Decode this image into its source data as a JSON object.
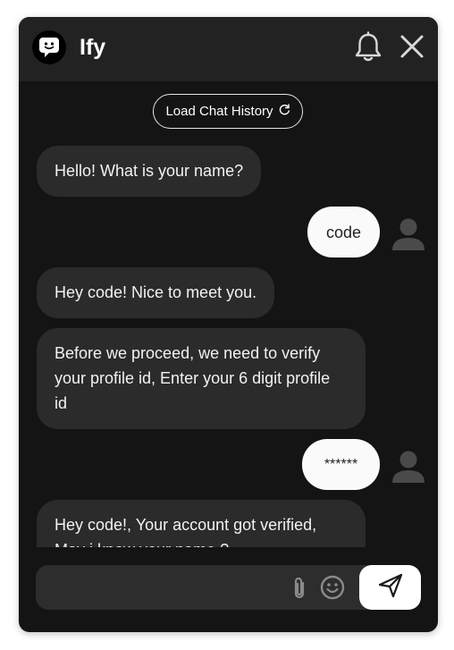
{
  "header": {
    "title": "Ify",
    "logo_icon": "chat-bubble-icon",
    "bell_icon": "bell-icon",
    "close_icon": "close-icon"
  },
  "chat": {
    "load_history_label": "Load Chat History",
    "load_history_icon": "refresh-icon",
    "messages": [
      {
        "sender": "bot",
        "text": "Hello! What is your name?"
      },
      {
        "sender": "user",
        "text": "code"
      },
      {
        "sender": "bot",
        "text": "Hey code! Nice to meet you."
      },
      {
        "sender": "bot",
        "lines": [
          "Before we proceed, we need to verify",
          "your profile id, Enter your 6 digit profile",
          "id"
        ]
      },
      {
        "sender": "user",
        "text": "******"
      },
      {
        "sender": "bot",
        "lines": [
          "Hey code!, Your account got verified,",
          "May i know your name ?"
        ]
      }
    ]
  },
  "composer": {
    "placeholder": "",
    "attach_icon": "paperclip-icon",
    "emoji_icon": "smiley-icon",
    "send_icon": "send-icon"
  },
  "colors": {
    "panel_bg": "#141414",
    "header_bg": "#222223",
    "bot_bubble": "#2b2b2c",
    "user_bubble": "#fafafa",
    "composer_bg": "#2d2d2e"
  }
}
